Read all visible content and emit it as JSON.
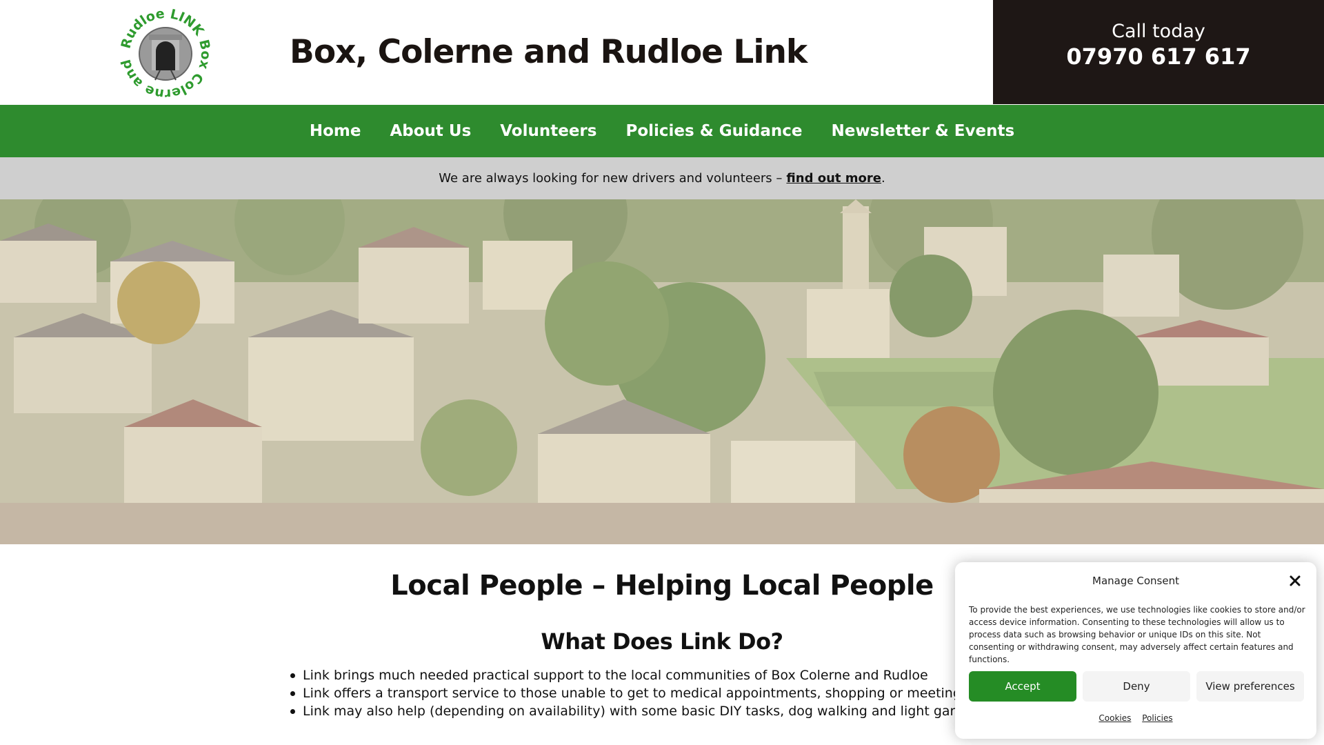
{
  "header": {
    "site_title": "Box, Colerne and Rudloe Link",
    "logo_text": "Rudloe LINK Box Colerne and",
    "call_label": "Call today",
    "call_number": "07970 617 617"
  },
  "nav": {
    "items": [
      {
        "label": "Home"
      },
      {
        "label": "About Us"
      },
      {
        "label": "Volunteers"
      },
      {
        "label": "Policies & Guidance"
      },
      {
        "label": "Newsletter & Events"
      }
    ]
  },
  "notice": {
    "text": "We are always looking for new drivers and volunteers –",
    "link": "find out more",
    "suffix": "."
  },
  "main": {
    "title": "Local People – Helping Local People",
    "subtitle": "What Does Link Do?",
    "bullets": [
      "Link brings much needed practical support to the local communities of Box Colerne and Rudloe",
      "Link offers a transport service to those unable to get to medical appointments, shopping or meeting with f",
      "Link may also help (depending on availability) with some basic DIY tasks, dog walking and light gardening"
    ]
  },
  "consent": {
    "title": "Manage Consent",
    "text": "To provide the best experiences, we use technologies like cookies to store and/or access device information. Consenting to these technologies will allow us to process data such as browsing behavior or unique IDs on this site. Not consenting or withdrawing consent, may adversely affect certain features and functions.",
    "accept_label": "Accept",
    "deny_label": "Deny",
    "preferences_label": "View preferences",
    "links": [
      "Cookies",
      "Policies"
    ]
  },
  "colors": {
    "nav_green": "#2e8b2e",
    "accept_green": "#258c25",
    "call_box_dark": "#1e1715",
    "notice_gray": "#cfcfcf"
  }
}
